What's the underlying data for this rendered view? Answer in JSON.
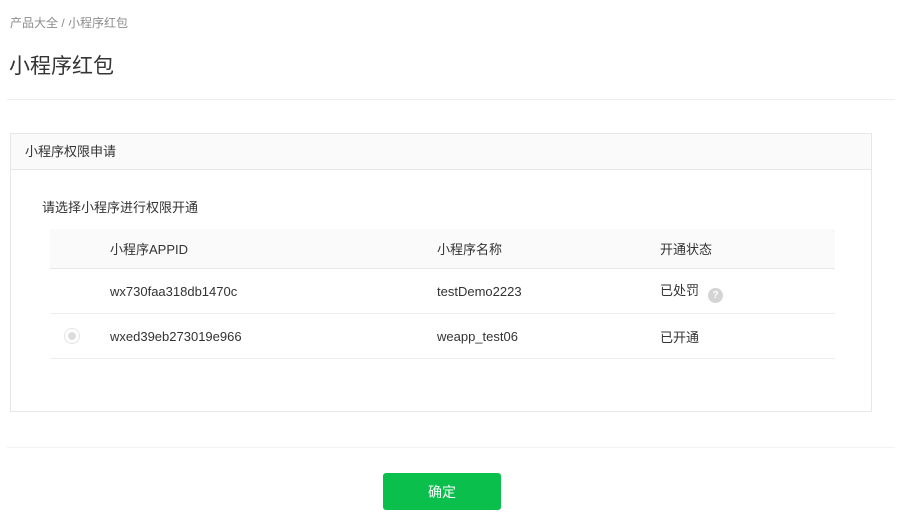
{
  "breadcrumb": {
    "parent": "产品大全",
    "separator": " / ",
    "current": "小程序红包"
  },
  "page": {
    "title": "小程序红包"
  },
  "panel": {
    "title": "小程序权限申请",
    "instruction": "请选择小程序进行权限开通",
    "table": {
      "columns": [
        "小程序APPID",
        "小程序名称",
        "开通状态"
      ],
      "rows": [
        {
          "appid": "wx730faa318db1470c",
          "name": "testDemo2223",
          "status": "已处罚",
          "selectable": false,
          "has_help_icon": true
        },
        {
          "appid": "wxed39eb273019e966",
          "name": "weapp_test06",
          "status": "已开通",
          "selectable": true,
          "has_help_icon": false
        }
      ]
    }
  },
  "icons": {
    "help": "?"
  },
  "footer": {
    "confirm_label": "确定"
  },
  "colors": {
    "accent_green": "#0abf4c",
    "text_primary": "#333333",
    "text_muted": "#8c8c8c",
    "border": "#e7e7e7",
    "header_bg": "#fafafa"
  }
}
